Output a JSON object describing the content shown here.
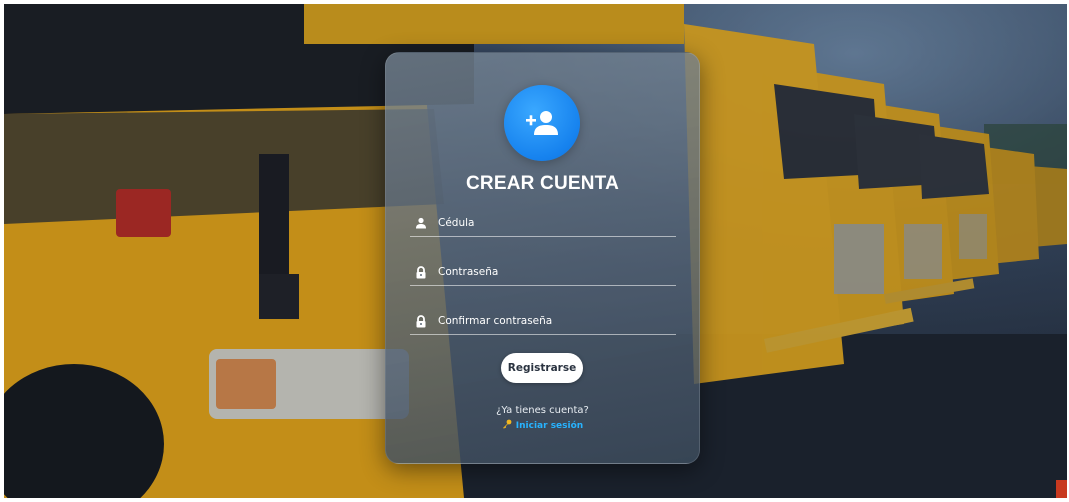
{
  "card": {
    "title": "CREAR CUENTA",
    "avatar_icon": "person-add-icon"
  },
  "form": {
    "cedula": {
      "placeholder": "Cédula",
      "icon": "user-icon"
    },
    "password": {
      "placeholder": "Contraseña",
      "icon": "lock-icon"
    },
    "confirm_password": {
      "placeholder": "Confirmar contraseña",
      "icon": "lock-icon"
    },
    "submit_label": "Registrarse"
  },
  "footer": {
    "question": "¿Ya tienes cuenta?",
    "login_label": "Iniciar sesión",
    "login_icon": "key-icon"
  },
  "colors": {
    "accent_blue": "#1682ee",
    "link_blue": "#27b3ff",
    "bus_yellow": "#e9a514"
  }
}
